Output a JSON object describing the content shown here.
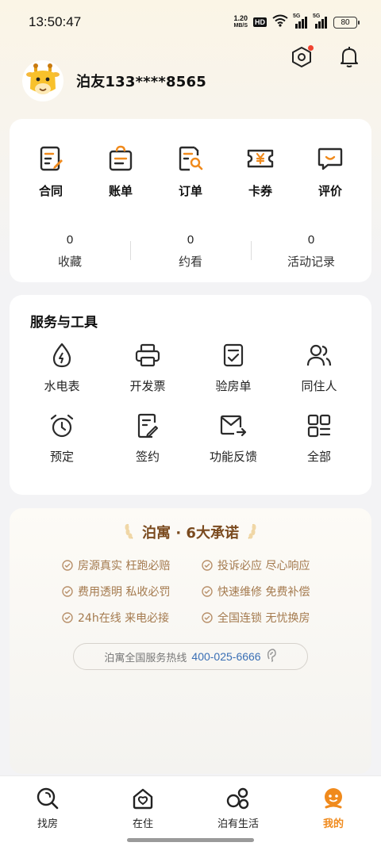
{
  "status_bar": {
    "time": "13:50:47",
    "net_speed_value": "1.20",
    "net_speed_unit": "MB/S",
    "hd_label": "HD",
    "signal1_label": "5G",
    "signal2_label": "5G",
    "battery_level": "80"
  },
  "header": {
    "settings_icon": "hexagon-settings-icon",
    "notification_icon": "bell-icon",
    "has_settings_dot": true
  },
  "profile": {
    "username": "泊友133****8565",
    "avatar_icon": "giraffe-avatar"
  },
  "quick_actions": [
    {
      "label": "合同",
      "icon": "contract-icon"
    },
    {
      "label": "账单",
      "icon": "bill-icon"
    },
    {
      "label": "订单",
      "icon": "order-search-icon"
    },
    {
      "label": "卡券",
      "icon": "coupon-icon"
    },
    {
      "label": "评价",
      "icon": "review-chat-icon"
    }
  ],
  "stats": [
    {
      "count": "0",
      "label": "收藏"
    },
    {
      "count": "0",
      "label": "约看"
    },
    {
      "count": "0",
      "label": "活动记录"
    }
  ],
  "services": {
    "title": "服务与工具",
    "items": [
      {
        "label": "水电表",
        "icon": "utility-drop-icon"
      },
      {
        "label": "开发票",
        "icon": "printer-icon"
      },
      {
        "label": "验房单",
        "icon": "checklist-icon"
      },
      {
        "label": "同住人",
        "icon": "roommates-icon"
      },
      {
        "label": "预定",
        "icon": "alarm-clock-icon"
      },
      {
        "label": "签约",
        "icon": "sign-document-icon"
      },
      {
        "label": "功能反馈",
        "icon": "mail-feedback-icon"
      },
      {
        "label": "全部",
        "icon": "grid-all-icon"
      }
    ]
  },
  "promise": {
    "title": "泊寓 · 6大承诺",
    "items": [
      "房源真实 枉跑必赔",
      "投诉必应 尽心响应",
      "费用透明 私收必罚",
      "快速维修 免费补偿",
      "24h在线 来电必接",
      "全国连锁 无忧换房"
    ],
    "hotline_label": "泊寓全国服务热线",
    "hotline_number": "400-025-6666"
  },
  "tabbar": [
    {
      "label": "找房",
      "icon": "search-house-icon",
      "active": false
    },
    {
      "label": "在住",
      "icon": "home-heart-icon",
      "active": false
    },
    {
      "label": "泊有生活",
      "icon": "life-circles-icon",
      "active": false
    },
    {
      "label": "我的",
      "icon": "profile-mascot-icon",
      "active": true
    }
  ],
  "colors": {
    "accent_orange": "#f08a1c",
    "promise_gold": "#a47a4e",
    "hotline_blue": "#3a6fb5"
  }
}
